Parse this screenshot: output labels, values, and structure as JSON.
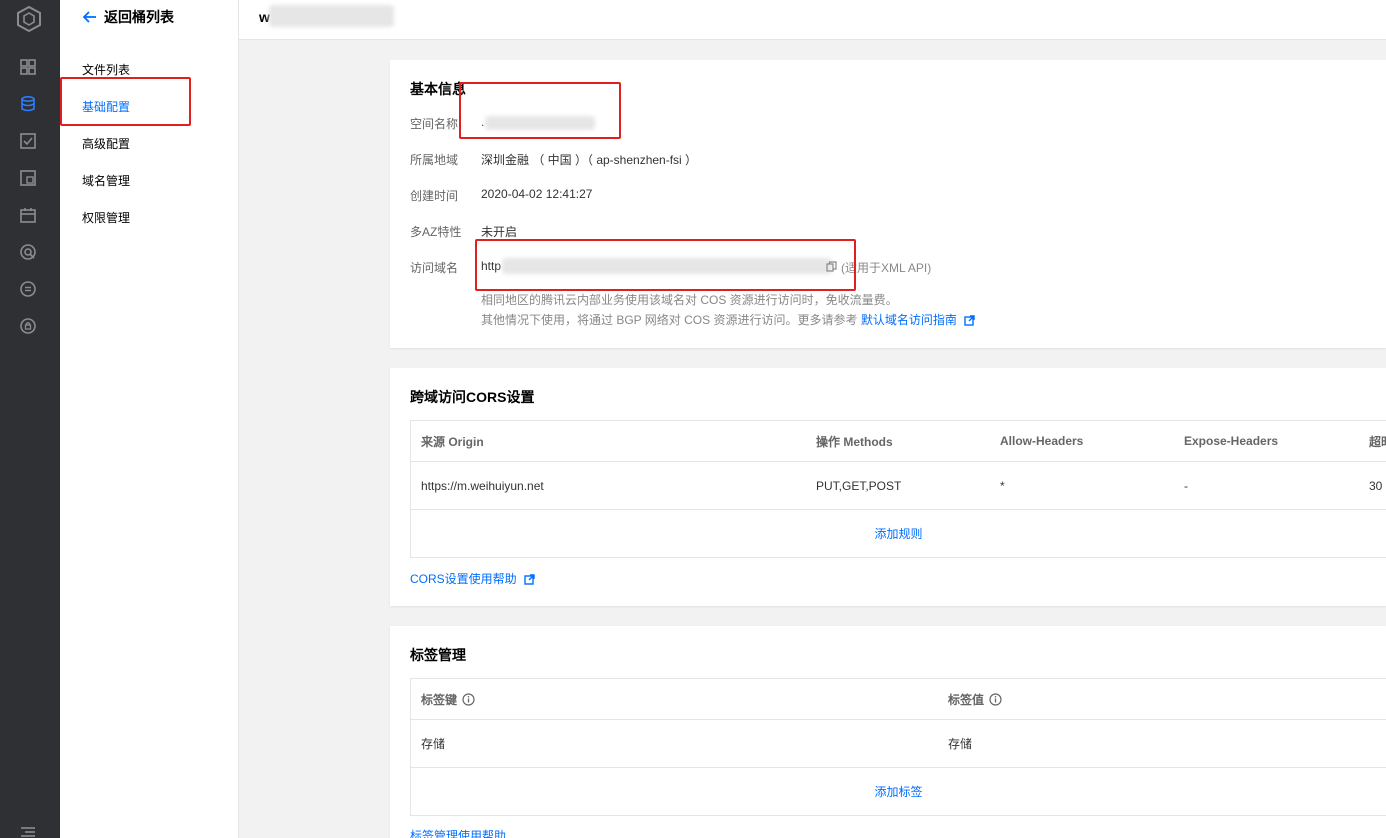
{
  "sidebar": {
    "icons": [
      "cube-logo-icon",
      "grid-icon",
      "database-icon",
      "checkbox-icon",
      "box-icon",
      "calendar-icon",
      "shield-icon",
      "circle-equals-icon",
      "lock-circle-icon",
      "list-icon"
    ]
  },
  "subnav": {
    "back_label": "返回桶列表",
    "items": [
      {
        "label": "文件列表",
        "active": false
      },
      {
        "label": "基础配置",
        "active": true
      },
      {
        "label": "高级配置",
        "active": false
      },
      {
        "label": "域名管理",
        "active": false
      },
      {
        "label": "权限管理",
        "active": false
      }
    ]
  },
  "topbar": {
    "bucket_name_prefix": "w"
  },
  "basic_info": {
    "title": "基本信息",
    "rows": [
      {
        "label": "空间名称",
        "value": "",
        "value_prefix": "."
      },
      {
        "label": "所属地域",
        "value": "深圳金融 （ 中国 ）（ ap-shenzhen-fsi ）"
      },
      {
        "label": "创建时间",
        "value": "2020-04-02 12:41:27"
      },
      {
        "label": "多AZ特性",
        "value": "未开启"
      },
      {
        "label": "访问域名",
        "value": "http",
        "note": "(适用于XML API)"
      }
    ],
    "hint_line1": "相同地区的腾讯云内部业务使用该域名对 COS 资源进行访问时，免收流量费。",
    "hint_line2": "其他情况下使用，将通过 BGP 网络对 COS 资源进行访问。更多请参考",
    "hint_link": "默认域名访问指南"
  },
  "cors": {
    "title": "跨域访问CORS设置",
    "columns": [
      "来源 Origin",
      "操作 Methods",
      "Allow-Headers",
      "Expose-Headers",
      "超时"
    ],
    "rows": [
      [
        "https://m.weihuiyun.net",
        "PUT,GET,POST",
        "*",
        "-",
        "30"
      ]
    ],
    "add_label": "添加规则",
    "help_link": "CORS设置使用帮助"
  },
  "tags": {
    "title": "标签管理",
    "columns": [
      "标签键",
      "标签值"
    ],
    "rows": [
      [
        "存储",
        "存储"
      ]
    ],
    "add_label": "添加标签",
    "help_link": "标签管理使用帮助"
  },
  "colors": {
    "accent": "#006eff",
    "annotation": "#e02020",
    "rail": "#2f3033"
  }
}
